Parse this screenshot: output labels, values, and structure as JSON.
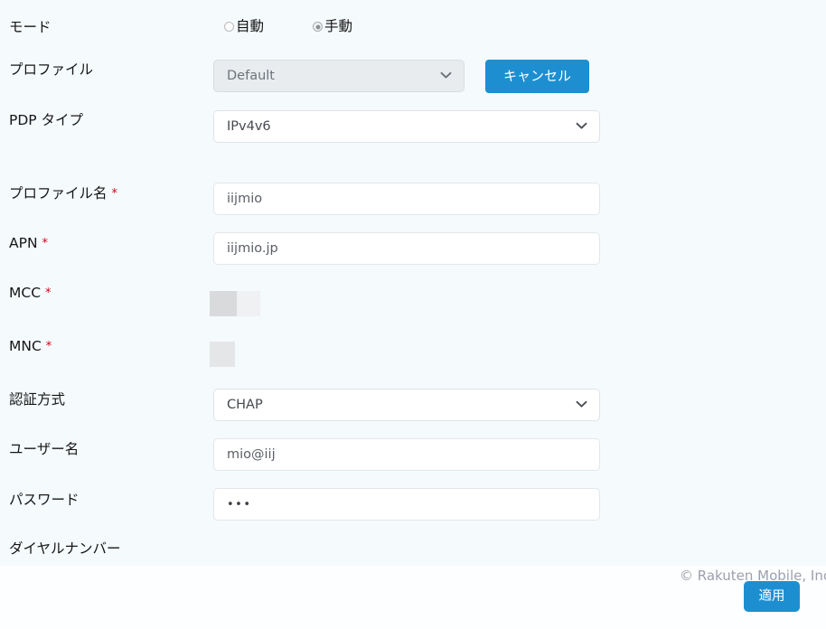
{
  "colors": {
    "page_background": "#fdfeff",
    "form_background": "#f5fafc",
    "accent_blue": "#1d8fd1",
    "required_red": "#d0021b",
    "label_text": "#161616",
    "input_text": "#5a5f66",
    "disabled_select_bg": "#e9ecef",
    "skeleton_dark": "#d9dadc",
    "skeleton_light": "#eff1f3",
    "footer_text": "#9d9fae"
  },
  "form": {
    "mode": {
      "label": "モード",
      "options": [
        {
          "label": "自動",
          "checked": false
        },
        {
          "label": "手動",
          "checked": true
        }
      ]
    },
    "profile": {
      "label": "プロファイル",
      "value": "Default",
      "disabled": true,
      "chevron_icon": "chevron-down-icon"
    },
    "pdp_type": {
      "label": "PDP タイプ",
      "value": "IPv4v6",
      "chevron_icon": "chevron-down-icon"
    },
    "profile_name": {
      "label": "プロファイル名",
      "required_marker": "*",
      "value": "iijmio",
      "placeholder": "iijmio"
    },
    "apn": {
      "label": "APN",
      "required_marker": "*",
      "value": "iijmio.jp",
      "placeholder": "iijmio.jp"
    },
    "mcc": {
      "label": "MCC",
      "required_marker": "*",
      "value": "",
      "state": "placeholder-blocks"
    },
    "mnc": {
      "label": "MNC",
      "required_marker": "*",
      "value": "",
      "state": "placeholder-blocks"
    },
    "auth_type": {
      "label": "認証方式",
      "value": "CHAP",
      "chevron_icon": "chevron-down-icon"
    },
    "username": {
      "label": "ユーザー名",
      "value": "mio@iij",
      "placeholder": "mio@iij"
    },
    "password": {
      "label": "パスワード",
      "value": "•••",
      "masked": true
    },
    "dial_number": {
      "label": "ダイヤルナンバー",
      "value": ""
    }
  },
  "buttons": {
    "cancel": "キャンセル",
    "apply": "適用"
  },
  "footer": {
    "copyright": "© Rakuten Mobile, Inc."
  }
}
